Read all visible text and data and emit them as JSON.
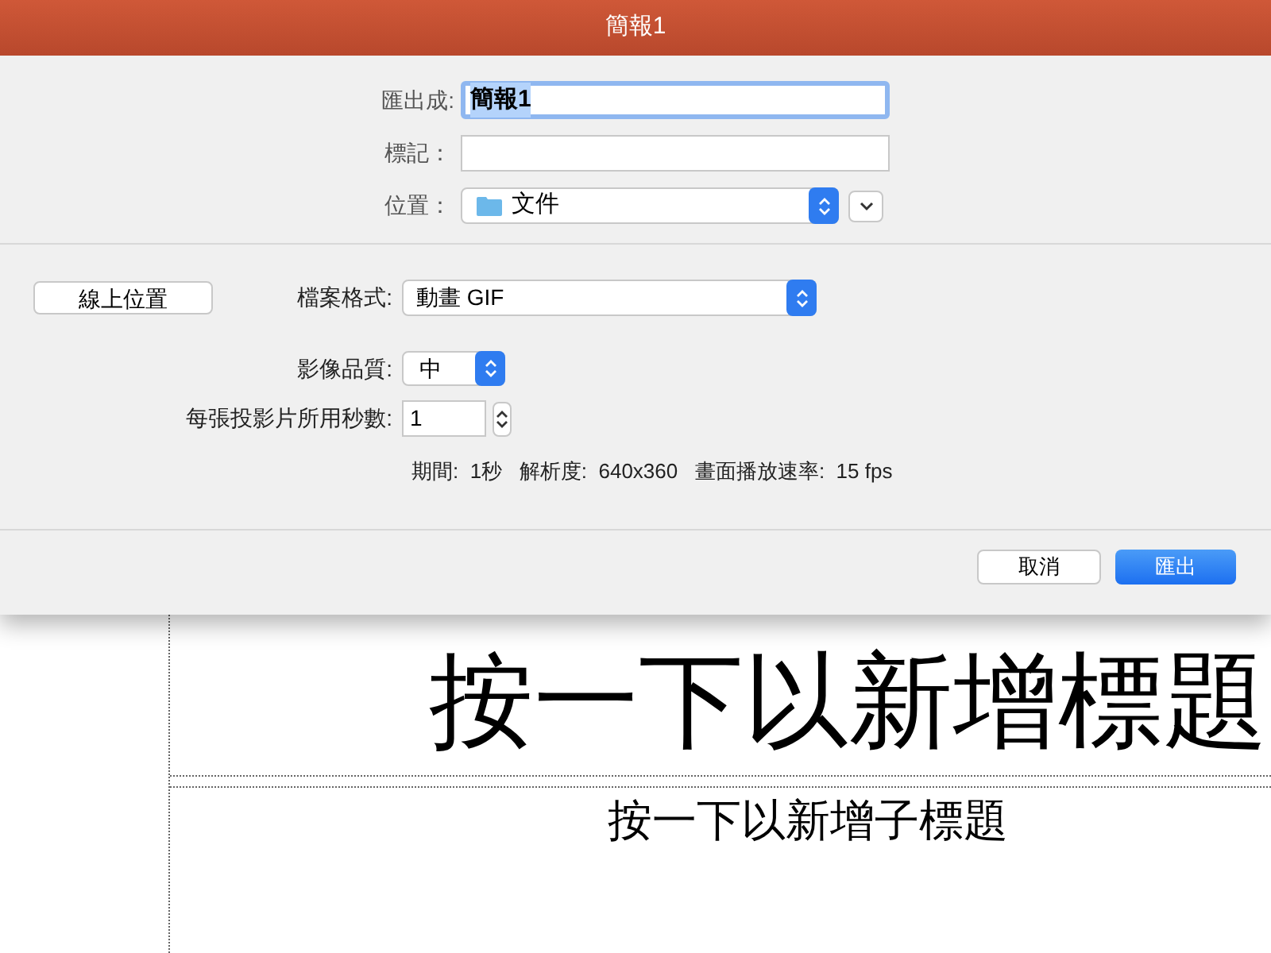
{
  "window": {
    "title": "簡報1"
  },
  "save": {
    "name_label": "匯出成:",
    "name_value": "簡報1",
    "name_text_selected": true,
    "tags_label": "標記：",
    "location_label": "位置：",
    "location_value": "文件"
  },
  "online_button": "線上位置",
  "options": {
    "format_label": "檔案格式:",
    "format_value": "動畫 GIF",
    "quality_label": "影像品質:",
    "quality_value": "中",
    "seconds_label": "每張投影片所用秒數:",
    "seconds_value": "1",
    "info": "期間:  1秒   解析度:  640x360   畫面播放速率:  15 fps"
  },
  "buttons": [
    {
      "label": "取消",
      "kind": "secondary"
    },
    {
      "label": "匯出",
      "kind": "primary"
    }
  ],
  "slide": {
    "title_placeholder": "按一下以新增標題",
    "subtitle_placeholder": "按一下以新增子標題"
  }
}
